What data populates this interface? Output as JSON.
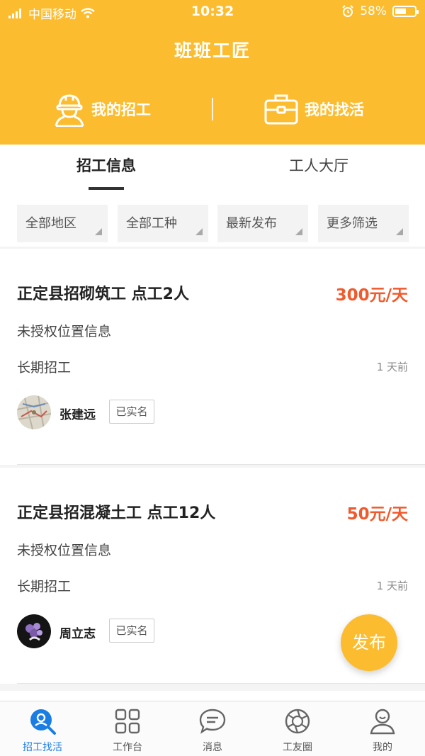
{
  "status_bar": {
    "carrier": "中国移动",
    "time": "10:32",
    "battery": "58%",
    "battery_level": 0.58
  },
  "header": {
    "title": "班班工匠",
    "my_recruit": "我的招工",
    "my_jobs": "我的找活"
  },
  "tabs": {
    "active": "招工信息",
    "inactive": "工人大厅"
  },
  "filters": [
    "全部地区",
    "全部工种",
    "最新发布",
    "更多筛选"
  ],
  "listings": [
    {
      "title": "正定县招砌筑工 点工2人",
      "price": "300元/天",
      "location": "未授权位置信息",
      "type": "长期招工",
      "time": "1 天前",
      "name": "张建远",
      "badge": "已实名"
    },
    {
      "title": "正定县招混凝土工 点工12人",
      "price": "50元/天",
      "location": "未授权位置信息",
      "type": "长期招工",
      "time": "1 天前",
      "name": "周立志",
      "badge": "已实名"
    }
  ],
  "publish_button": "发布",
  "tabbar": {
    "items": [
      {
        "label": "招工找活",
        "icon": "search-person-icon"
      },
      {
        "label": "工作台",
        "icon": "grid-icon"
      },
      {
        "label": "消息",
        "icon": "chat-bubble-icon"
      },
      {
        "label": "工友圈",
        "icon": "aperture-icon"
      },
      {
        "label": "我的",
        "icon": "user-icon"
      }
    ]
  },
  "colors": {
    "brand": "#fbbc2f",
    "price": "#f05a2c",
    "tab_active": "#1a7de3"
  }
}
